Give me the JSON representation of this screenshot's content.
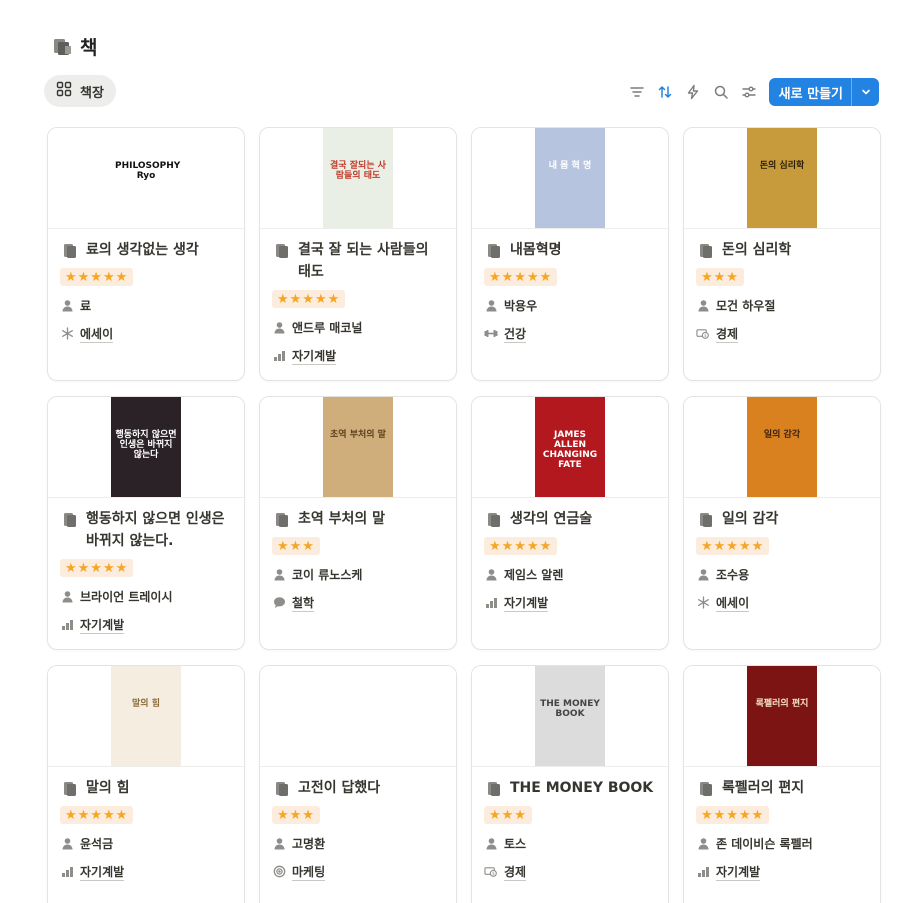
{
  "page": {
    "title": "책"
  },
  "view": {
    "label": "책장"
  },
  "toolbar": {
    "new_label": "새로 만들기",
    "accent": "#2383e2"
  },
  "rating_color": "#f5a623",
  "books": [
    {
      "name": "료의 생각없는 생각",
      "stars": "★★★★★",
      "author": "료",
      "category": "에세이",
      "category_icon": "asterisk-icon",
      "cover_text": "PHILOSOPHY Ryo",
      "cover_bg": "#ffffff",
      "cover_fg": "#111111"
    },
    {
      "name": "결국 잘 되는 사람들의 태도",
      "stars": "★★★★★",
      "author": "앤드루 매코널",
      "category": "자기계발",
      "category_icon": "bar-chart-icon",
      "cover_text": "결국 잘되는 사람들의 태도",
      "cover_bg": "#e9efe4",
      "cover_fg": "#c0392b"
    },
    {
      "name": "내몸혁명",
      "stars": "★★★★★",
      "author": "박용우",
      "category": "건강",
      "category_icon": "dumbbell-icon",
      "cover_text": "내 몸 혁 명",
      "cover_bg": "#b7c4e0",
      "cover_fg": "#ffffff"
    },
    {
      "name": "돈의 심리학",
      "stars": "★★★",
      "author": "모건 하우절",
      "category": "경제",
      "category_icon": "money-icon",
      "cover_text": "돈의 심리학",
      "cover_bg": "#c79a3c",
      "cover_fg": "#2b1d07"
    },
    {
      "name": "행동하지 않으면 인생은 바뀌지 않는다.",
      "stars": "★★★★★",
      "author": "브라이언 트레이시",
      "category": "자기계발",
      "category_icon": "bar-chart-icon",
      "cover_text": "행동하지 않으면 인생은 바뀌지 않는다",
      "cover_bg": "#2a2226",
      "cover_fg": "#ffffff"
    },
    {
      "name": "초역 부처의 말",
      "stars": "★★★",
      "author": "코이 류노스케",
      "category": "철학",
      "category_icon": "speech-icon",
      "cover_text": "초역 부처의 말",
      "cover_bg": "#cfae7c",
      "cover_fg": "#5a3d1a"
    },
    {
      "name": "생각의 연금술",
      "stars": "★★★★★",
      "author": "제임스 알렌",
      "category": "자기계발",
      "category_icon": "bar-chart-icon",
      "cover_text": "JAMES ALLEN CHANGING FATE",
      "cover_bg": "#b3181e",
      "cover_fg": "#ffffff"
    },
    {
      "name": "일의 감각",
      "stars": "★★★★★",
      "author": "조수용",
      "category": "에세이",
      "category_icon": "asterisk-icon",
      "cover_text": "일의 감각",
      "cover_bg": "#d9811f",
      "cover_fg": "#3a2312"
    },
    {
      "name": "말의 힘",
      "stars": "★★★★★",
      "author": "윤석금",
      "category": "자기계발",
      "category_icon": "bar-chart-icon",
      "cover_text": "말의 힘",
      "cover_bg": "#f4ede0",
      "cover_fg": "#8a6a3a"
    },
    {
      "name": "고전이 답했다",
      "stars": "★★★",
      "author": "고명환",
      "category": "마케팅",
      "category_icon": "target-icon",
      "cover_text": "",
      "cover_bg": "#ffffff",
      "cover_fg": "#ffffff"
    },
    {
      "name": "THE MONEY BOOK",
      "stars": "★★★",
      "author": "토스",
      "category": "경제",
      "category_icon": "money-icon",
      "cover_text": "THE MONEY BOOK",
      "cover_bg": "#dcdcdc",
      "cover_fg": "#444444"
    },
    {
      "name": "록펠러의 편지",
      "stars": "★★★★★",
      "author": "존 데이비슨 록펠러",
      "category": "자기계발",
      "category_icon": "bar-chart-icon",
      "cover_text": "록펠러의 편지",
      "cover_bg": "#7d1414",
      "cover_fg": "#f3e3c0"
    }
  ]
}
